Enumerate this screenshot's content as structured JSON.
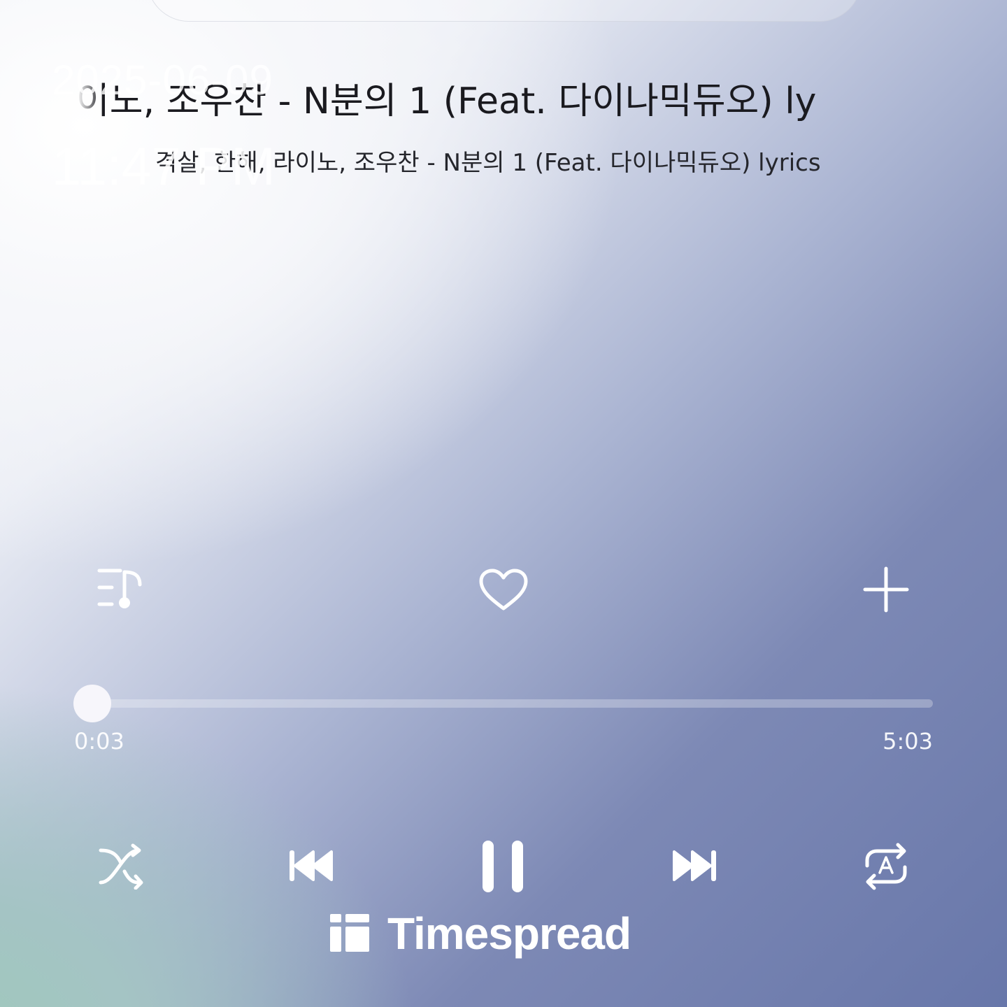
{
  "overlay": {
    "date": "2025-06-09",
    "time": "11:47 PM"
  },
  "track": {
    "title_scroll": ", 라이노, 조우찬 - N분의 1 (Feat. 다이나믹듀오) ly",
    "subtitle": "격살, 한해, 라이노, 조우찬 - N분의 1 (Feat. 다이나믹듀오) lyrics"
  },
  "actions": {
    "playlist_icon": "playlist-music-icon",
    "like_icon": "heart-outline-icon",
    "add_icon": "plus-icon"
  },
  "playback": {
    "elapsed": "0:03",
    "duration": "5:03",
    "progress_fraction": 0.01
  },
  "controls": {
    "shuffle_icon": "shuffle-icon",
    "previous_icon": "skip-previous-icon",
    "pause_icon": "pause-icon",
    "next_icon": "skip-next-icon",
    "repeat_icon": "repeat-a-icon"
  },
  "brand": {
    "name": "Timespread",
    "logo_icon": "timespread-logo-icon"
  },
  "colors": {
    "text_dark": "#1a1a1f",
    "icon_white": "#ffffff",
    "gradient_end": "#6877aa"
  }
}
